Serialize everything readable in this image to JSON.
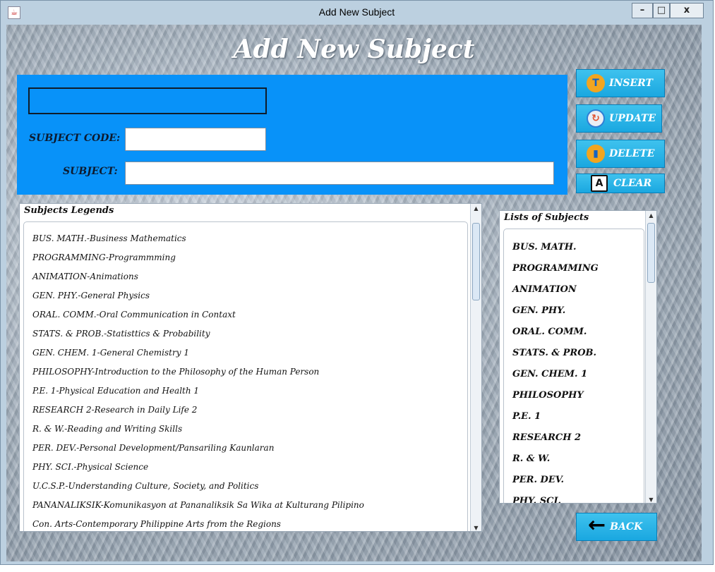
{
  "window": {
    "title": "Add New Subject",
    "minimize_label": "–",
    "maximize_label": "□",
    "close_label": "x"
  },
  "heading": "Add New Subject",
  "form": {
    "subject_code_label": "SUBJECT CODE:",
    "subject_label": "SUBJECT:",
    "subject_code_value": "",
    "subject_value": ""
  },
  "buttons": {
    "insert": "INSERT",
    "update": "UPDATE",
    "delete": "DELETE",
    "clear": "CLEAR",
    "back": "BACK"
  },
  "legends": {
    "title": "Subjects Legends",
    "items": [
      "BUS. MATH.-Business Mathematics",
      "PROGRAMMING-Programmming",
      "ANIMATION-Animations",
      "GEN. PHY.-General Physics",
      "ORAL. COMM.-Oral Communication in Contaxt",
      "STATS. & PROB.-Statisttics & Probability",
      "GEN. CHEM. 1-General Chemistry 1",
      "PHILOSOPHY-Introduction to the Philosophy of the Human Person",
      "P.E. 1-Physical Education and Health 1",
      "RESEARCH 2-Research in Daily Life 2",
      "R. & W.-Reading and Writing Skills",
      "PER. DEV.-Personal Development/Pansariling Kaunlaran",
      "PHY. SCI.-Physical Science",
      "U.C.S.P.-Understanding Culture, Society, and Politics",
      "PANANALIKSIK-Komunikasyon at Pananaliksik Sa Wika at Kulturang Pilipino",
      "Con. Arts-Contemporary Philippine Arts from the Regions"
    ]
  },
  "subjects": {
    "title": "Lists of Subjects",
    "items": [
      "BUS. MATH.",
      "PROGRAMMING",
      "ANIMATION",
      "GEN. PHY.",
      "ORAL. COMM.",
      "STATS. & PROB.",
      "GEN. CHEM. 1",
      "PHILOSOPHY",
      "P.E. 1",
      "RESEARCH 2",
      "R. & W.",
      "PER. DEV.",
      "PHY. SCI."
    ]
  },
  "scrollbars": {
    "up_arrow": "▲",
    "down_arrow": "▼"
  },
  "icons": {
    "insert": "T",
    "update": "↻",
    "delete": "▮",
    "clear": "A",
    "back": "←"
  },
  "colors": {
    "panel": "#0892f9",
    "button": "#1aa7e0"
  }
}
